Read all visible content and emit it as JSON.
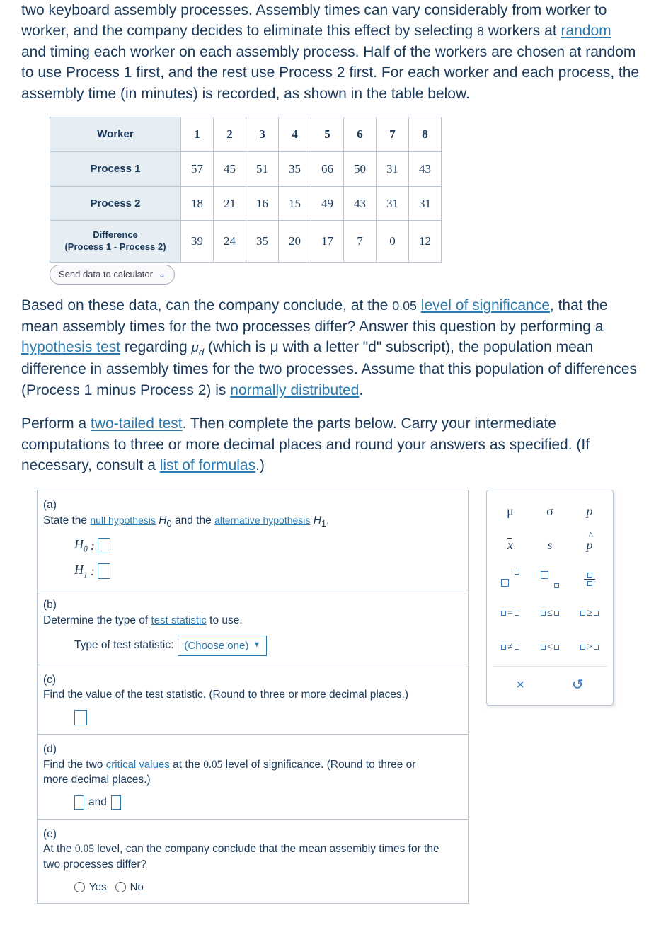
{
  "intro": {
    "part1": "two keyboard assembly processes. Assembly times can vary considerably from worker to worker, and the company decides to eliminate this effect by selecting ",
    "n_workers": "8",
    "part2": " workers at ",
    "link_random": "random",
    "part3": " and timing each worker on each assembly process. Half of the workers are chosen at random to use Process 1 first, and the rest use Process 2 first. For each worker and each process, the assembly time (in minutes) is recorded, as shown in the table below."
  },
  "table": {
    "headers": [
      "Worker",
      "1",
      "2",
      "3",
      "4",
      "5",
      "6",
      "7",
      "8"
    ],
    "rows": [
      {
        "label": "Process 1",
        "vals": [
          "57",
          "45",
          "51",
          "35",
          "66",
          "50",
          "31",
          "43"
        ]
      },
      {
        "label": "Process 2",
        "vals": [
          "18",
          "21",
          "16",
          "15",
          "49",
          "43",
          "31",
          "31"
        ]
      },
      {
        "label": "Difference",
        "sublabel": "(Process 1 - Process 2)",
        "vals": [
          "39",
          "24",
          "35",
          "20",
          "17",
          "7",
          "0",
          "12"
        ]
      }
    ]
  },
  "send_button": "Send data to calculator",
  "q1": {
    "p1": "Based on these data, can the company conclude, at the ",
    "alpha": "0.05",
    "link_level": "level of significance",
    "p2": ", that the mean assembly times for the two processes differ? Answer this question by performing a ",
    "link_hyp": "hypothesis test",
    "p3": " regarding ",
    "mud": "μ",
    "mud_sub": "d",
    "p4": " (which is μ with a letter \"d\" subscript), the population mean difference in assembly times for the two processes. Assume that this population of differences (Process 1 minus Process 2) is ",
    "link_normal": "normally distributed",
    "p5": "."
  },
  "q2": {
    "p1": "Perform a ",
    "link_twotail": "two-tailed test",
    "p2": ". Then complete the parts below. Carry your intermediate computations to three or more decimal places and round your answers as specified. (If necessary, consult a ",
    "link_formulas": "list of formulas",
    "p3": ".)"
  },
  "parts": {
    "a": {
      "label": "(a)",
      "text1": "State the ",
      "link1": "null hypothesis",
      "h0": " H",
      "h0sub": "0",
      "text2": " and the ",
      "link2": "alternative hypothesis",
      "h1": " H",
      "h1sub": "1",
      "text3": ".",
      "h0row": "H",
      "h1row": "H",
      "colon": " :"
    },
    "b": {
      "label": "(b)",
      "text1": "Determine the type of ",
      "link1": "test statistic",
      "text2": " to use.",
      "type_label": "Type of test statistic:",
      "dropdown": "(Choose one)"
    },
    "c": {
      "label": "(c)",
      "text": "Find the value of the test statistic. (Round to three or more decimal places.)"
    },
    "d": {
      "label": "(d)",
      "text1": "Find the two ",
      "link1": "critical values",
      "text2": " at the ",
      "alpha": "0.05",
      "text3": " level of significance. (Round to three or more decimal places.)",
      "and": " and "
    },
    "e": {
      "label": "(e)",
      "text1": "At the ",
      "alpha": "0.05",
      "text2": " level, can the company conclude that the mean assembly times for the two processes differ?",
      "yes": "Yes",
      "no": "No"
    }
  },
  "palette": {
    "mu": "μ",
    "sigma": "σ",
    "p": "p",
    "xbar": "x",
    "s": "s",
    "phat": "p",
    "eq": "=",
    "le": "≤",
    "ge": "≥",
    "ne": "≠",
    "lt": "<",
    "gt": ">",
    "close": "×",
    "reset": "↺"
  }
}
